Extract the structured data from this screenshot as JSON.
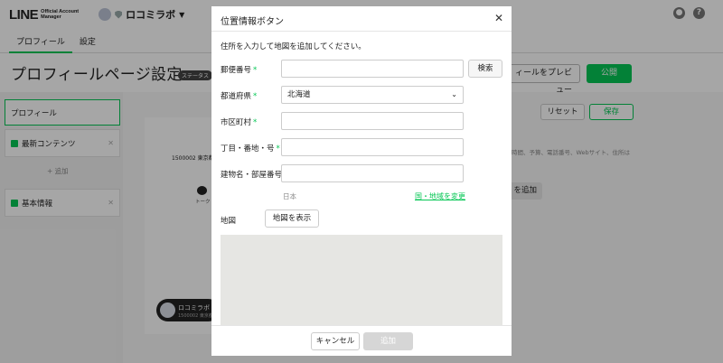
{
  "app": {
    "logo_main": "LINE",
    "logo_sub": "Official Account Manager",
    "account_name": "ロコミラボ",
    "help_icon_glyph": "?"
  },
  "tabs": [
    {
      "label": "プロフィール",
      "active": true
    },
    {
      "label": "設定",
      "active": false
    }
  ],
  "page": {
    "title": "プロフィールページ設定",
    "status_badge": "ステータス",
    "preview_label": "ィールをプレビュー",
    "publish_label": "公開",
    "reset_label": "リセット",
    "save_label": "保存",
    "hint_text": "時間、予算、電話番号、Webサイト、住所は",
    "bg_add_label": "を追加"
  },
  "sidebar": {
    "items": [
      {
        "label": "プロフィール"
      },
      {
        "label": "最新コンテンツ"
      },
      {
        "label": "基本情報"
      }
    ],
    "add_label": "+ 追加"
  },
  "preview": {
    "address_snippet": "1500002 東京都",
    "chat_label": "トーク",
    "pill_name": "ロコミラボ",
    "pill_sub": "1500002 東京都"
  },
  "modal": {
    "title": "位置情報ボタン",
    "instruction": "住所を入力して地図を追加してください。",
    "fields": {
      "postal": {
        "label": "郵便番号",
        "value": ""
      },
      "prefecture": {
        "label": "都道府県",
        "value": "北海道"
      },
      "city": {
        "label": "市区町村",
        "value": ""
      },
      "street": {
        "label": "丁目・番地・号",
        "value": ""
      },
      "building": {
        "label": "建物名・部屋番号",
        "value": ""
      }
    },
    "required_mark": "*",
    "search_label": "検索",
    "country": "日本",
    "change_country_label": "国・地域を変更",
    "map_label": "地図",
    "show_map_label": "地図を表示",
    "cancel_label": "キャンセル",
    "add_label": "追加"
  },
  "colors": {
    "accent": "#06c755",
    "overlay": "rgba(0,0,0,0.35)"
  }
}
